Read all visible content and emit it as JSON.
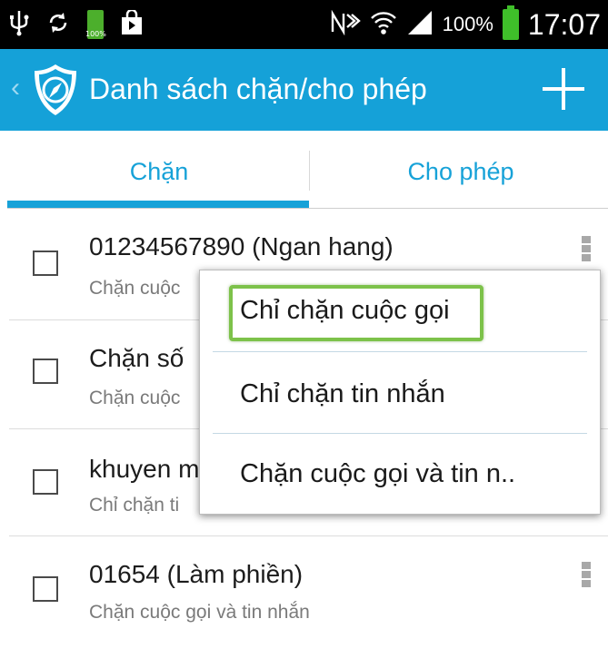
{
  "status_bar": {
    "battery_percent": "100%",
    "time": "17:07",
    "small_battery_label": "100%",
    "icons": [
      "usb-icon",
      "sync-icon",
      "battery-small-icon",
      "shopping-bag-icon",
      "nfc-icon",
      "wifi-icon",
      "signal-icon",
      "battery-icon"
    ]
  },
  "app_bar": {
    "title": "Danh sách chặn/cho phép",
    "back_icon": "chevron-left-icon",
    "logo_icon": "shield-icon",
    "action_icon": "plus-icon"
  },
  "tabs": [
    {
      "label": "Chặn",
      "selected": true
    },
    {
      "label": "Cho phép",
      "selected": false
    }
  ],
  "list": [
    {
      "title": "01234567890 (Ngan hang)",
      "subtitle": "Chặn cuộc",
      "checked": false,
      "has_menu": true
    },
    {
      "title": "Chặn số",
      "subtitle": "Chặn cuộc",
      "checked": false,
      "has_menu": false
    },
    {
      "title": "khuyen m",
      "subtitle": "Chỉ chặn ti",
      "checked": false,
      "has_menu": false
    },
    {
      "title": "01654 (Làm phiền)",
      "subtitle": "Chặn cuộc gọi và tin nhắn",
      "checked": false,
      "has_menu": true
    }
  ],
  "popup_menu": {
    "items": [
      {
        "label": "Chỉ chặn cuộc gọi",
        "highlighted": true
      },
      {
        "label": "Chỉ chặn tin nhắn",
        "highlighted": false
      },
      {
        "label": "Chặn cuộc gọi và tin n..",
        "highlighted": false
      }
    ]
  },
  "colors": {
    "app_bar": "#15a1d8",
    "accent": "#17a2d8",
    "highlight_border": "#7dc24a",
    "status_bar": "#000000"
  }
}
